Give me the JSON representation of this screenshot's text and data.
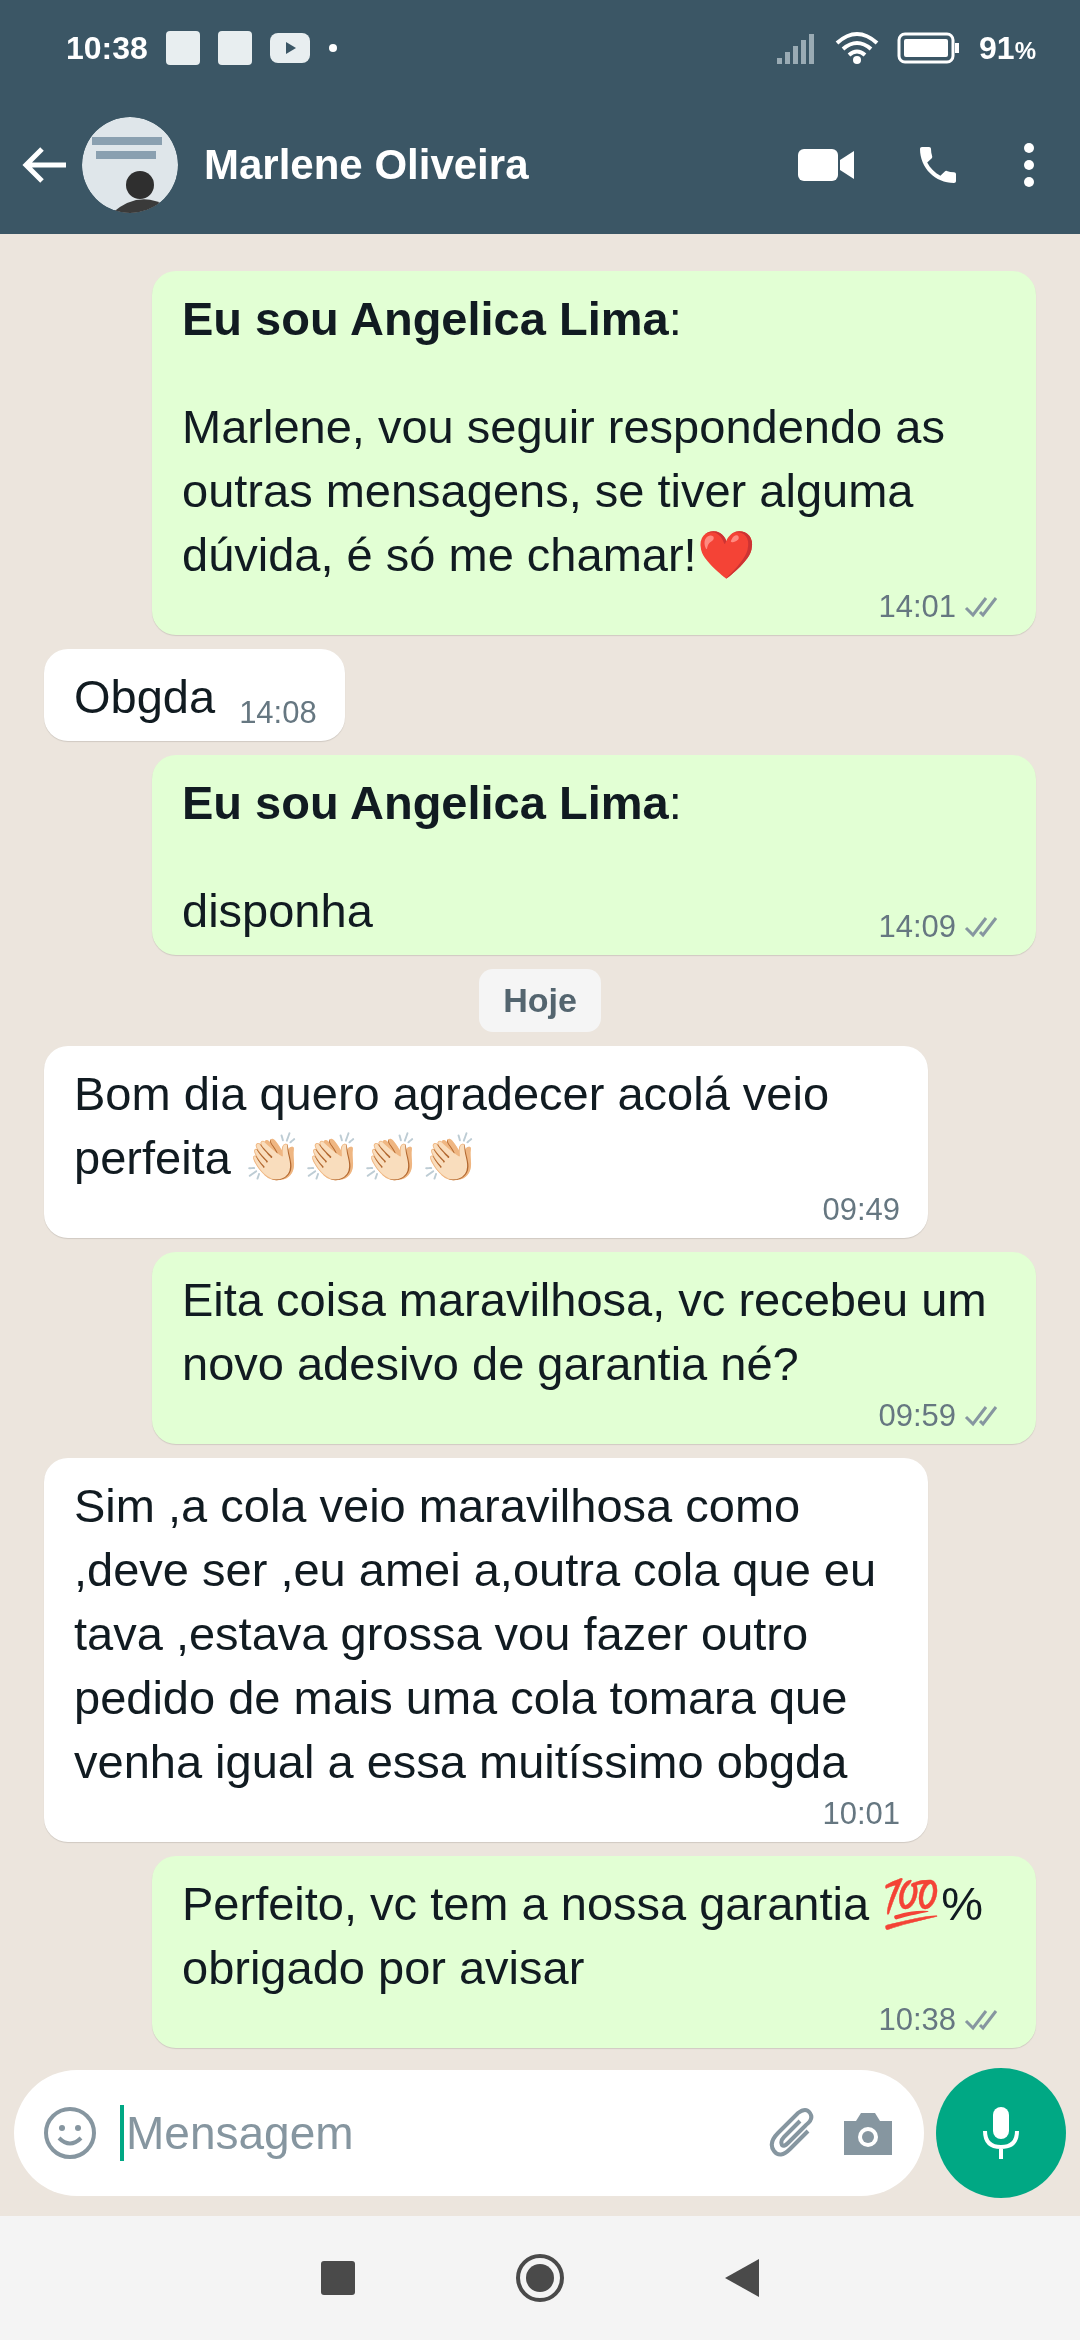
{
  "status_bar": {
    "time": "10:38",
    "battery": "91",
    "battery_unit": "%"
  },
  "header": {
    "contact_name": "Marlene Oliveira"
  },
  "items": [
    {
      "kind": "message",
      "outgoing": true,
      "sender": "**Eu sou Angelica Lima**:",
      "text": "Marlene, vou seguir respondendo as outras mensagens, se tiver alguma dúvida, é só me chamar!❤️",
      "time": "14:01",
      "read": false
    },
    {
      "kind": "message",
      "outgoing": false,
      "text": "Obgda",
      "time": "14:08"
    },
    {
      "kind": "message",
      "outgoing": true,
      "sender": "**Eu sou Angelica Lima**:",
      "text": "disponha",
      "time": "14:09",
      "read": false
    },
    {
      "kind": "date",
      "text": "Hoje"
    },
    {
      "kind": "message",
      "outgoing": false,
      "text": "Bom dia quero agradecer acolá veio perfeita 👏🏻👏🏻👏🏻👏🏻",
      "time": "09:49"
    },
    {
      "kind": "message",
      "outgoing": true,
      "text": "Eita coisa maravilhosa, vc recebeu um novo adesivo de garantia né?",
      "time": "09:59",
      "read": false
    },
    {
      "kind": "message",
      "outgoing": false,
      "text": "Sim ,a cola veio maravilhosa como ,deve ser ,eu amei a,outra cola que eu tava ,estava grossa vou fazer outro pedido de mais uma cola tomara que venha igual a essa muitíssimo obgda",
      "time": "10:01"
    },
    {
      "kind": "message",
      "outgoing": true,
      "text": "Perfeito, vc tem a nossa garantia 💯% obrigado por avisar",
      "time": "10:38",
      "read": false
    }
  ],
  "composer": {
    "placeholder": "Mensagem"
  }
}
